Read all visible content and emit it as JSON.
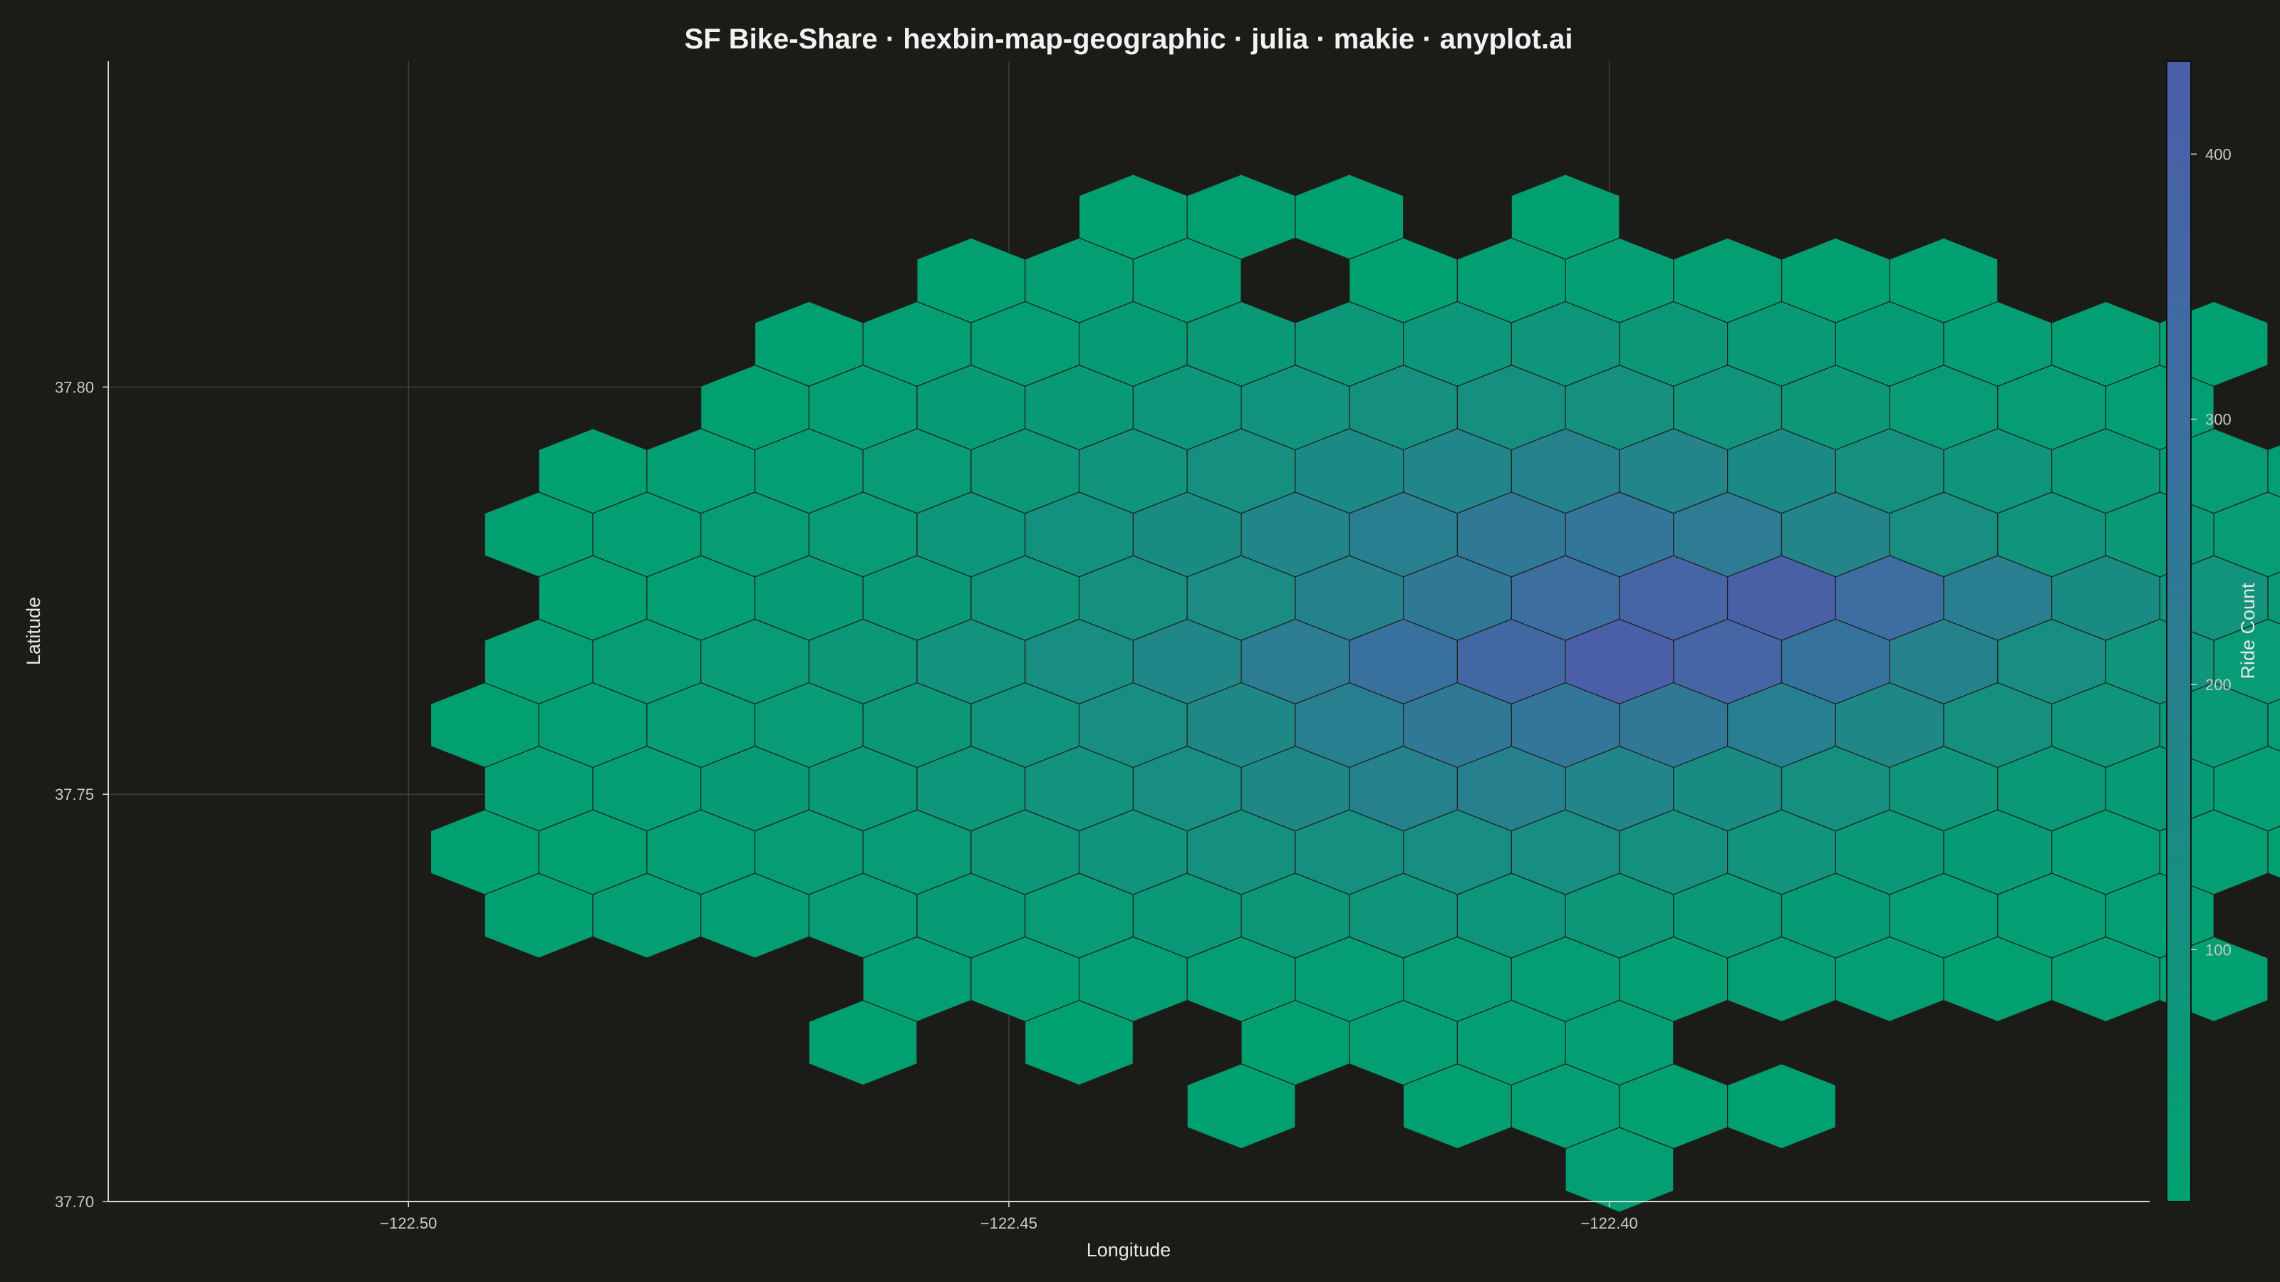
{
  "chart_data": {
    "type": "heatmap",
    "subtype": "hexbin-map",
    "title": "SF Bike-Share · hexbin-map-geographic · julia · makie · anyplot.ai",
    "xlabel": "Longitude",
    "ylabel": "Latitude",
    "xlim": [
      -122.525,
      -122.355
    ],
    "ylim": [
      37.7,
      37.84
    ],
    "xticks": [
      -122.5,
      -122.45,
      -122.4
    ],
    "xtick_labels": [
      "−122.50",
      "−122.45",
      "−122.40"
    ],
    "yticks": [
      37.7,
      37.75,
      37.8
    ],
    "ytick_labels": [
      "37.70",
      "37.75",
      "37.80"
    ],
    "grid": true,
    "colorbar": {
      "label": "Ride Count",
      "range": [
        5,
        435
      ],
      "ticks": [
        100,
        200,
        300,
        400
      ],
      "tick_labels": [
        "100",
        "200",
        "300",
        "400"
      ],
      "colormap": [
        "#00a170",
        "#1c8a84",
        "#3b6fa0",
        "#4b5ea8"
      ]
    },
    "hexbin": {
      "lon0": -122.47115,
      "lat0": 37.7039,
      "dlon": 0.009,
      "dlat": 0.0078,
      "rows": [
        {
          "r": 0,
          "cells": [
            [
              8,
              20
            ]
          ]
        },
        {
          "r": 1,
          "cells": [
            [
              4,
              10
            ],
            [
              6,
              15
            ],
            [
              7,
              20
            ],
            [
              8,
              15
            ],
            [
              9,
              10
            ]
          ]
        },
        {
          "r": 2,
          "cells": [
            [
              1,
              15
            ],
            [
              3,
              10
            ],
            [
              5,
              15
            ],
            [
              6,
              20
            ],
            [
              7,
              25
            ],
            [
              8,
              20
            ]
          ]
        },
        {
          "r": 3,
          "cells": [
            [
              1,
              20
            ],
            [
              2,
              25
            ],
            [
              3,
              30
            ],
            [
              4,
              25
            ],
            [
              5,
              30
            ],
            [
              6,
              35
            ],
            [
              7,
              30
            ],
            [
              8,
              25
            ],
            [
              9,
              30
            ],
            [
              10,
              20
            ],
            [
              11,
              15
            ],
            [
              12,
              20
            ],
            [
              13,
              15
            ]
          ]
        },
        {
          "r": 4,
          "cells": [
            [
              -2,
              15
            ],
            [
              -1,
              20
            ],
            [
              0,
              25
            ],
            [
              1,
              35
            ],
            [
              2,
              40
            ],
            [
              3,
              50
            ],
            [
              4,
              60
            ],
            [
              5,
              70
            ],
            [
              6,
              80
            ],
            [
              7,
              75
            ],
            [
              8,
              65
            ],
            [
              9,
              55
            ],
            [
              10,
              40
            ],
            [
              11,
              30
            ],
            [
              12,
              25
            ],
            [
              13,
              20
            ]
          ]
        },
        {
          "r": 5,
          "cells": [
            [
              -3,
              10
            ],
            [
              -2,
              15
            ],
            [
              -1,
              25
            ],
            [
              0,
              35
            ],
            [
              1,
              50
            ],
            [
              2,
              70
            ],
            [
              3,
              90
            ],
            [
              4,
              110
            ],
            [
              5,
              120
            ],
            [
              6,
              130
            ],
            [
              7,
              125
            ],
            [
              8,
              110
            ],
            [
              9,
              90
            ],
            [
              10,
              60
            ],
            [
              11,
              40
            ],
            [
              12,
              25
            ],
            [
              13,
              20
            ],
            [
              14,
              15
            ]
          ]
        },
        {
          "r": 6,
          "cells": [
            [
              -2,
              20
            ],
            [
              -1,
              30
            ],
            [
              0,
              40
            ],
            [
              1,
              55
            ],
            [
              2,
              75
            ],
            [
              3,
              100
            ],
            [
              4,
              130
            ],
            [
              5,
              160
            ],
            [
              6,
              190
            ],
            [
              7,
              200
            ],
            [
              8,
              175
            ],
            [
              9,
              140
            ],
            [
              10,
              110
            ],
            [
              11,
              80
            ],
            [
              12,
              60
            ],
            [
              13,
              40
            ],
            [
              14,
              25
            ]
          ]
        },
        {
          "r": 7,
          "cells": [
            [
              -3,
              15
            ],
            [
              -2,
              25
            ],
            [
              -1,
              35
            ],
            [
              0,
              50
            ],
            [
              1,
              70
            ],
            [
              2,
              95
            ],
            [
              3,
              125
            ],
            [
              4,
              165
            ],
            [
              5,
              205
            ],
            [
              6,
              240
            ],
            [
              7,
              260
            ],
            [
              8,
              245
            ],
            [
              9,
              205
            ],
            [
              10,
              160
            ],
            [
              11,
              110
            ],
            [
              12,
              80
            ],
            [
              13,
              55
            ],
            [
              14,
              35
            ],
            [
              15,
              20
            ]
          ]
        },
        {
          "r": 8,
          "cells": [
            [
              -2,
              20
            ],
            [
              -1,
              35
            ],
            [
              0,
              50
            ],
            [
              1,
              70
            ],
            [
              2,
              100
            ],
            [
              3,
              130
            ],
            [
              4,
              170
            ],
            [
              5,
              220
            ],
            [
              6,
              280
            ],
            [
              7,
              350
            ],
            [
              8,
              430
            ],
            [
              9,
              380
            ],
            [
              10,
              270
            ],
            [
              11,
              190
            ],
            [
              12,
              130
            ],
            [
              13,
              85
            ],
            [
              14,
              50
            ],
            [
              15,
              25
            ]
          ]
        },
        {
          "r": 9,
          "cells": [
            [
              -2,
              15
            ],
            [
              -1,
              25
            ],
            [
              0,
              40
            ],
            [
              1,
              55
            ],
            [
              2,
              80
            ],
            [
              3,
              110
            ],
            [
              4,
              145
            ],
            [
              5,
              190
            ],
            [
              6,
              240
            ],
            [
              7,
              300
            ],
            [
              8,
              380
            ],
            [
              9,
              420
            ],
            [
              10,
              310
            ],
            [
              11,
              210
            ],
            [
              12,
              140
            ],
            [
              13,
              90
            ],
            [
              14,
              55
            ],
            [
              15,
              30
            ],
            [
              16,
              15
            ]
          ]
        },
        {
          "r": 10,
          "cells": [
            [
              -2,
              15
            ],
            [
              -1,
              25
            ],
            [
              0,
              35
            ],
            [
              1,
              50
            ],
            [
              2,
              75
            ],
            [
              3,
              105
            ],
            [
              4,
              140
            ],
            [
              5,
              175
            ],
            [
              6,
              210
            ],
            [
              7,
              240
            ],
            [
              8,
              260
            ],
            [
              9,
              230
            ],
            [
              10,
              180
            ],
            [
              11,
              125
            ],
            [
              12,
              85
            ],
            [
              13,
              55
            ],
            [
              14,
              35
            ]
          ]
        },
        {
          "r": 11,
          "cells": [
            [
              -2,
              10
            ],
            [
              -1,
              20
            ],
            [
              0,
              30
            ],
            [
              1,
              45
            ],
            [
              2,
              65
            ],
            [
              3,
              90
            ],
            [
              4,
              120
            ],
            [
              5,
              150
            ],
            [
              6,
              175
            ],
            [
              7,
              190
            ],
            [
              8,
              180
            ],
            [
              9,
              150
            ],
            [
              10,
              110
            ],
            [
              11,
              80
            ],
            [
              12,
              55
            ],
            [
              13,
              35
            ],
            [
              14,
              20
            ],
            [
              15,
              10
            ]
          ]
        },
        {
          "r": 12,
          "cells": [
            [
              0,
              15
            ],
            [
              1,
              25
            ],
            [
              2,
              40
            ],
            [
              3,
              55
            ],
            [
              4,
              75
            ],
            [
              5,
              95
            ],
            [
              6,
              110
            ],
            [
              7,
              120
            ],
            [
              8,
              110
            ],
            [
              9,
              90
            ],
            [
              10,
              70
            ],
            [
              11,
              50
            ],
            [
              12,
              35
            ],
            [
              13,
              20
            ]
          ]
        },
        {
          "r": 13,
          "cells": [
            [
              0,
              10
            ],
            [
              1,
              20
            ],
            [
              2,
              30
            ],
            [
              3,
              40
            ],
            [
              4,
              55
            ],
            [
              5,
              65
            ],
            [
              6,
              75
            ],
            [
              7,
              80
            ],
            [
              8,
              70
            ],
            [
              9,
              55
            ],
            [
              10,
              40
            ],
            [
              11,
              30
            ],
            [
              12,
              20
            ],
            [
              13,
              10
            ]
          ]
        },
        {
          "r": 14,
          "cells": [
            [
              2,
              15
            ],
            [
              3,
              20
            ],
            [
              4,
              25
            ],
            [
              6,
              10
            ],
            [
              7,
              20
            ],
            [
              8,
              25
            ],
            [
              9,
              20
            ],
            [
              10,
              15
            ],
            [
              11,
              10
            ]
          ]
        },
        {
          "r": 15,
          "cells": [
            [
              3,
              10
            ],
            [
              4,
              15
            ],
            [
              5,
              10
            ],
            [
              7,
              15
            ]
          ]
        }
      ]
    }
  },
  "colors": {
    "background": "#1b1b18",
    "grid": "#3f3f3b",
    "axis": "#d9d9d9",
    "hex_edge": "#20201c"
  }
}
